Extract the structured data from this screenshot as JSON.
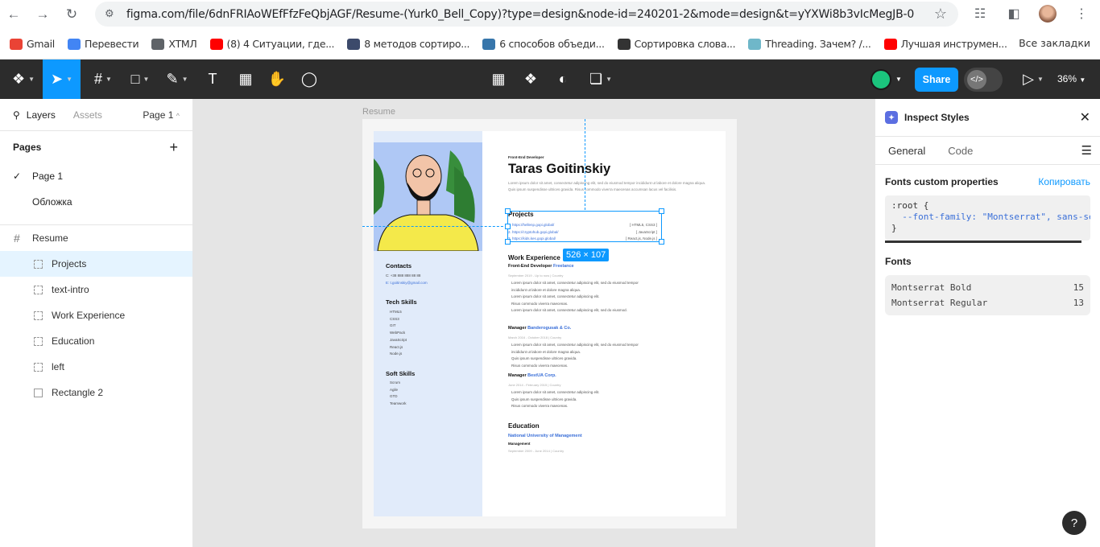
{
  "browser": {
    "url": "figma.com/file/6dnFRIAoWEfFfzFeQbjAGF/Resume-(Yurk0_Bell_Copy)?type=design&node-id=240201-2&mode=design&t=yYXWi8b3vIcMegJB-0",
    "bookmarks": [
      {
        "label": "Gmail",
        "icon": "gmail-icon",
        "color": "#ea4335"
      },
      {
        "label": "Перевести",
        "icon": "translate-icon",
        "color": "#4285f4"
      },
      {
        "label": "ХТМЛ",
        "icon": "folder-icon",
        "color": "#5f6368"
      },
      {
        "label": "(8) 4 Ситуации, где...",
        "icon": "youtube-icon",
        "color": "#ff0000"
      },
      {
        "label": "8 методов сортиро...",
        "icon": "site-icon",
        "color": "#3c4a6b"
      },
      {
        "label": "6 способов объеди...",
        "icon": "python-icon",
        "color": "#3776ab"
      },
      {
        "label": "Сортировка слова...",
        "icon": "td-icon",
        "color": "#333333"
      },
      {
        "label": "Threading. Зачем? /...",
        "icon": "habr-icon",
        "color": "#6fb7c9"
      },
      {
        "label": "Лучшая инструмен...",
        "icon": "youtube-icon",
        "color": "#ff0000"
      }
    ],
    "all_bookmarks": "Все закладки"
  },
  "toolbar": {
    "share_label": "Share",
    "zoom": "36%"
  },
  "left_panel": {
    "tabs": {
      "layers": "Layers",
      "assets": "Assets",
      "page_select": "Page 1"
    },
    "pages_title": "Pages",
    "pages": [
      {
        "label": "Page 1",
        "checked": true
      },
      {
        "label": "Обложка",
        "checked": false
      }
    ],
    "frame_name": "Resume",
    "layers": [
      {
        "label": "Projects",
        "selected": true
      },
      {
        "label": "text-intro",
        "selected": false
      },
      {
        "label": "Work Experience",
        "selected": false
      },
      {
        "label": "Education",
        "selected": false
      },
      {
        "label": "left",
        "selected": false
      },
      {
        "label": "Rectangle 2",
        "selected": false
      }
    ]
  },
  "canvas": {
    "frame_label": "Resume",
    "selection_size": "526 × 107",
    "resume": {
      "role": "Front-End Developer",
      "name": "Taras Goitinskiy",
      "intro": "Lorem ipsum dolor sit amet, consectetur adipiscing elit, sed do eiusmod tempor incididunt ut labore et dolore magna aliqua. Quis ipsum suspendisse ultrices gravida. Risus commodo viverra maecenas accumsan lacus vel facilisis.",
      "contacts_title": "Contacts",
      "contacts": [
        "C: +38 888 888 88 88",
        "E: t.goitinskiy@gmail.com"
      ],
      "tech_title": "Tech Skills",
      "tech": [
        "HTML5",
        "CSS3",
        "GIT",
        "WebPack",
        "JavaScript",
        "React.js",
        "Node.js"
      ],
      "soft_title": "Soft Skills",
      "soft": [
        "Scrum",
        "Agile",
        "GTD",
        "Teamwork"
      ],
      "projects_title": "Projects",
      "projects": [
        {
          "link": "1. https://hellenp.gopi.global/",
          "tag": "[ HTML5, CSS3 ]"
        },
        {
          "link": "2. https://cryptohub.gopi.global/",
          "tag": "[ JavaScript ]"
        },
        {
          "link": "3. https://kids.kes.gopi.global/",
          "tag": "[ React.js, Node.js ]"
        }
      ],
      "work_title": "Work Experience",
      "jobs": [
        {
          "title": "Front-End Developer",
          "company": "Freelance",
          "meta": "September 2019 - Up to now  |  Country",
          "bullets": [
            "Lorem ipsum dolor sit amet, consectetur adipiscing elit, sed do eiusmod tempor incididunt ut labore et dolore magna aliqua.",
            "Lorem ipsum dolor sit amet, consectetur adipiscing elit.",
            "Risus commodo viverra maecenas.",
            "Lorem ipsum dolor sit amet, consectetur adipiscing elit, sed do eiusmod."
          ]
        },
        {
          "title": "Manager",
          "company": "Banderogusak & Co.",
          "meta": "March 2016 - October 2018  |  Country",
          "bullets": [
            "Lorem ipsum dolor sit amet, consectetur adipiscing elit, sed do eiusmod tempor incididunt ut labore et dolore magna aliqua.",
            "Quis ipsum suspendisse ultrices gravida.",
            "Risus commodo viverra maecenas."
          ]
        },
        {
          "title": "Manager",
          "company": "BestUA Corp.",
          "meta": "June 2014 - February 2015  |  Country",
          "bullets": [
            "Lorem ipsum dolor sit amet, consectetur adipiscing elit.",
            "Quis ipsum suspendisse ultrices gravida.",
            "Risus commodo viverra maecenas."
          ]
        }
      ],
      "education_title": "Education",
      "university": "National University of Management",
      "degree": "Management",
      "edu_meta": "September 2009 - June 2014  |  Country"
    }
  },
  "right_panel": {
    "title": "Inspect Styles",
    "tabs": [
      "General",
      "Code"
    ],
    "fonts_props_title": "Fonts custom properties",
    "copy_label": "Копировать",
    "code_lines": [
      ":root {",
      "  --font-family: \"Montserrat\", sans-serif;",
      "}"
    ],
    "fonts_title": "Fonts",
    "fonts": [
      {
        "name": "Montserrat Bold",
        "count": "15"
      },
      {
        "name": "Montserrat Regular",
        "count": "13"
      }
    ]
  },
  "help_label": "?"
}
